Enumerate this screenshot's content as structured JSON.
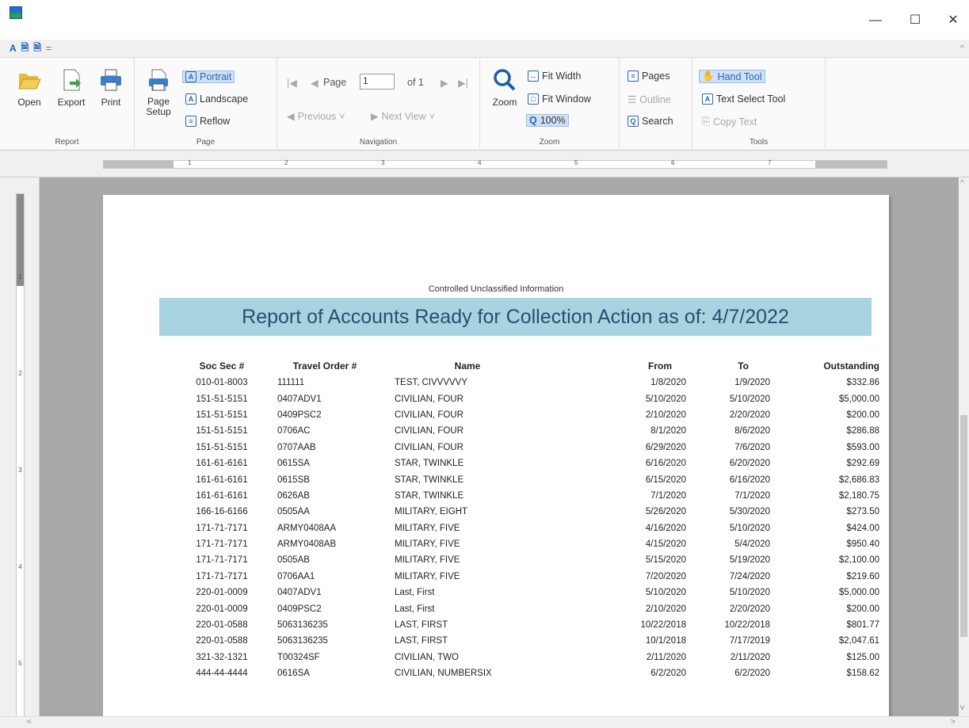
{
  "window": {
    "min": "—",
    "max": "☐",
    "close": "✕"
  },
  "qat": [
    "A",
    "🗎",
    "🗎",
    "="
  ],
  "ribbon": {
    "report": {
      "label": "Report",
      "open": "Open",
      "export": "Export",
      "print": "Print"
    },
    "page": {
      "label": "Page",
      "setup_line1": "Page",
      "setup_line2": "Setup",
      "portrait": "Portrait",
      "landscape": "Landscape",
      "reflow": "Reflow"
    },
    "navigation": {
      "label": "Navigation",
      "page": "Page",
      "page_value": "1",
      "of": "of 1",
      "previous": "Previous",
      "next": "Next View"
    },
    "zoom": {
      "label": "Zoom",
      "zoom": "Zoom",
      "fit_width": "Fit Width",
      "fit_window": "Fit Window",
      "zoom100": "100%"
    },
    "find": {
      "pages": "Pages",
      "outline": "Outline",
      "search": "Search"
    },
    "tools": {
      "label": "Tools",
      "hand": "Hand Tool",
      "text_select": "Text Select Tool",
      "copy_text": "Copy Text"
    }
  },
  "ruler": {
    "h_numbers": [
      "1",
      "2",
      "3",
      "4",
      "5",
      "6",
      "7"
    ],
    "v_numbers": [
      "1",
      "2",
      "3",
      "4",
      "5"
    ]
  },
  "report": {
    "cui": "Controlled Unclassified Information",
    "title": "Report of Accounts Ready for Collection Action as of: 4/7/2022",
    "headers": [
      "Soc Sec #",
      "Travel Order #",
      "Name",
      "From",
      "To",
      "Outstanding"
    ],
    "rows": [
      [
        "010-01-8003",
        "111111",
        "TEST, CIVVVVVY",
        "1/8/2020",
        "1/9/2020",
        "$332.86"
      ],
      [
        "151-51-5151",
        "0407ADV1",
        "CIVILIAN, FOUR",
        "5/10/2020",
        "5/10/2020",
        "$5,000.00"
      ],
      [
        "151-51-5151",
        "0409PSC2",
        "CIVILIAN, FOUR",
        "2/10/2020",
        "2/20/2020",
        "$200.00"
      ],
      [
        "151-51-5151",
        "0706AC",
        "CIVILIAN, FOUR",
        "8/1/2020",
        "8/6/2020",
        "$286.88"
      ],
      [
        "151-51-5151",
        "0707AAB",
        "CIVILIAN, FOUR",
        "6/29/2020",
        "7/6/2020",
        "$593.00"
      ],
      [
        "161-61-6161",
        "0615SA",
        "STAR, TWINKLE",
        "6/16/2020",
        "6/20/2020",
        "$292.69"
      ],
      [
        "161-61-6161",
        "0615SB",
        "STAR, TWINKLE",
        "6/15/2020",
        "6/16/2020",
        "$2,686.83"
      ],
      [
        "161-61-6161",
        "0626AB",
        "STAR, TWINKLE",
        "7/1/2020",
        "7/1/2020",
        "$2,180.75"
      ],
      [
        "166-16-6166",
        "0505AA",
        "MILITARY, EIGHT",
        "5/26/2020",
        "5/30/2020",
        "$273.50"
      ],
      [
        "171-71-7171",
        "ARMY0408AA",
        "MILITARY, FIVE",
        "4/16/2020",
        "5/10/2020",
        "$424.00"
      ],
      [
        "171-71-7171",
        "ARMY0408AB",
        "MILITARY, FIVE",
        "4/15/2020",
        "5/4/2020",
        "$950.40"
      ],
      [
        "171-71-7171",
        "0505AB",
        "MILITARY, FIVE",
        "5/15/2020",
        "5/19/2020",
        "$2,100.00"
      ],
      [
        "171-71-7171",
        "0706AA1",
        "MILITARY, FIVE",
        "7/20/2020",
        "7/24/2020",
        "$219.60"
      ],
      [
        "220-01-0009",
        "0407ADV1",
        "Last, First",
        "5/10/2020",
        "5/10/2020",
        "$5,000.00"
      ],
      [
        "220-01-0009",
        "0409PSC2",
        "Last, First",
        "2/10/2020",
        "2/20/2020",
        "$200.00"
      ],
      [
        "220-01-0588",
        "5063136235",
        "LAST, FIRST",
        "10/22/2018",
        "10/22/2018",
        "$801.77"
      ],
      [
        "220-01-0588",
        "5063136235",
        "LAST, FIRST",
        "10/1/2018",
        "7/17/2019",
        "$2,047.61"
      ],
      [
        "321-32-1321",
        "T00324SF",
        "CIVILIAN, TWO",
        "2/11/2020",
        "2/11/2020",
        "$125.00"
      ],
      [
        "444-44-4444",
        "0616SA",
        "CIVILIAN, NUMBERSIX",
        "6/2/2020",
        "6/2/2020",
        "$158.62"
      ]
    ]
  },
  "colors": {
    "banner": "#a8d4e2",
    "banner_text": "#26506e",
    "selected": "#cfe1f7"
  }
}
